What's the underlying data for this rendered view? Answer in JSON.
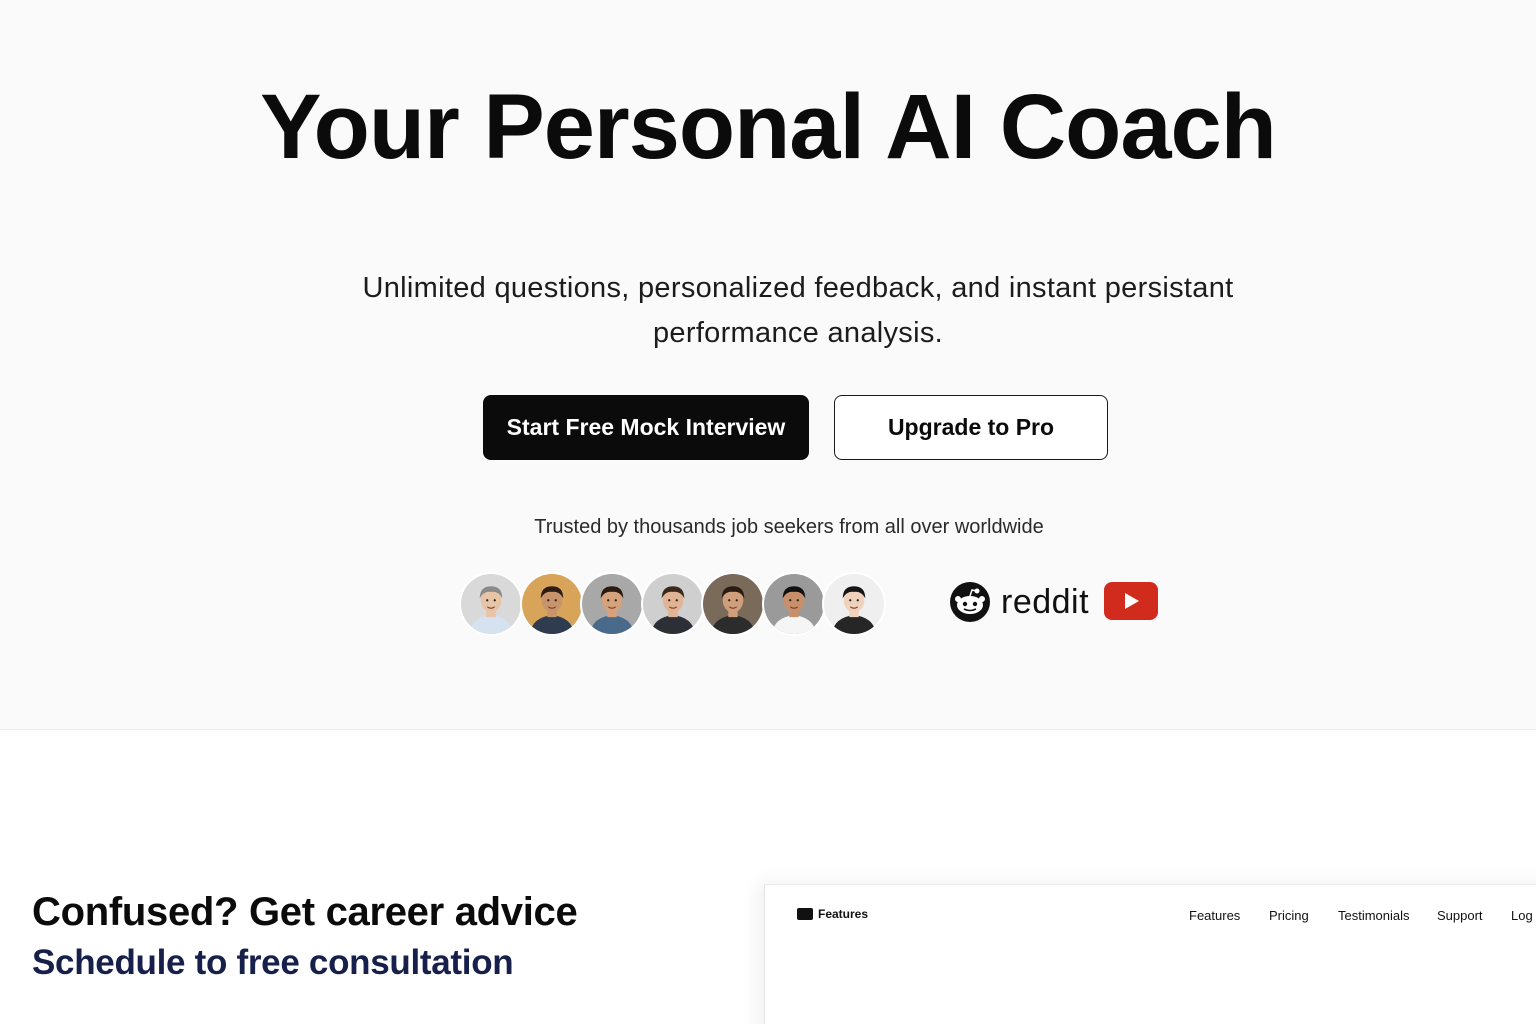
{
  "hero": {
    "title": "Your Personal AI Coach",
    "subtitle": "Unlimited questions, personalized feedback, and instant persistant performance analysis.",
    "primary_button": "Start Free Mock Interview",
    "secondary_button": "Upgrade to Pro",
    "trusted_text": "Trusted by thousands job seekers from all over worldwide",
    "avatars": [
      {
        "name": "avatar-1",
        "skin": "#e8c4a6",
        "hair": "#8a8a8a",
        "shirt": "#d6e2f0",
        "bg": "#d9d9d9"
      },
      {
        "name": "avatar-2",
        "skin": "#c8946c",
        "hair": "#2b1d14",
        "shirt": "#2f3b4f",
        "bg": "#d8a45a"
      },
      {
        "name": "avatar-3",
        "skin": "#d6a27c",
        "hair": "#2a1c12",
        "shirt": "#4a6a8c",
        "bg": "#a8a8a8"
      },
      {
        "name": "avatar-4",
        "skin": "#e0b494",
        "hair": "#3a2a1c",
        "shirt": "#2c2f36",
        "bg": "#cfcfcf"
      },
      {
        "name": "avatar-5",
        "skin": "#cf9f7c",
        "hair": "#2a1c12",
        "shirt": "#2c2c2c",
        "bg": "#7a6a5a"
      },
      {
        "name": "avatar-6",
        "skin": "#c7906a",
        "hair": "#111111",
        "shirt": "#f5f5f5",
        "bg": "#9a9a9a"
      },
      {
        "name": "avatar-7",
        "skin": "#f0d2bc",
        "hair": "#151515",
        "shirt": "#262626",
        "bg": "#efefef"
      }
    ],
    "brands": {
      "reddit": "reddit",
      "youtube_color": "#d12b1e"
    }
  },
  "lower": {
    "title": "Confused? Get career advice",
    "subtitle": "Schedule to free consultation"
  },
  "preview": {
    "brand": "Features",
    "nav": [
      "Features",
      "Pricing",
      "Testimonials",
      "Support",
      "Log"
    ]
  }
}
